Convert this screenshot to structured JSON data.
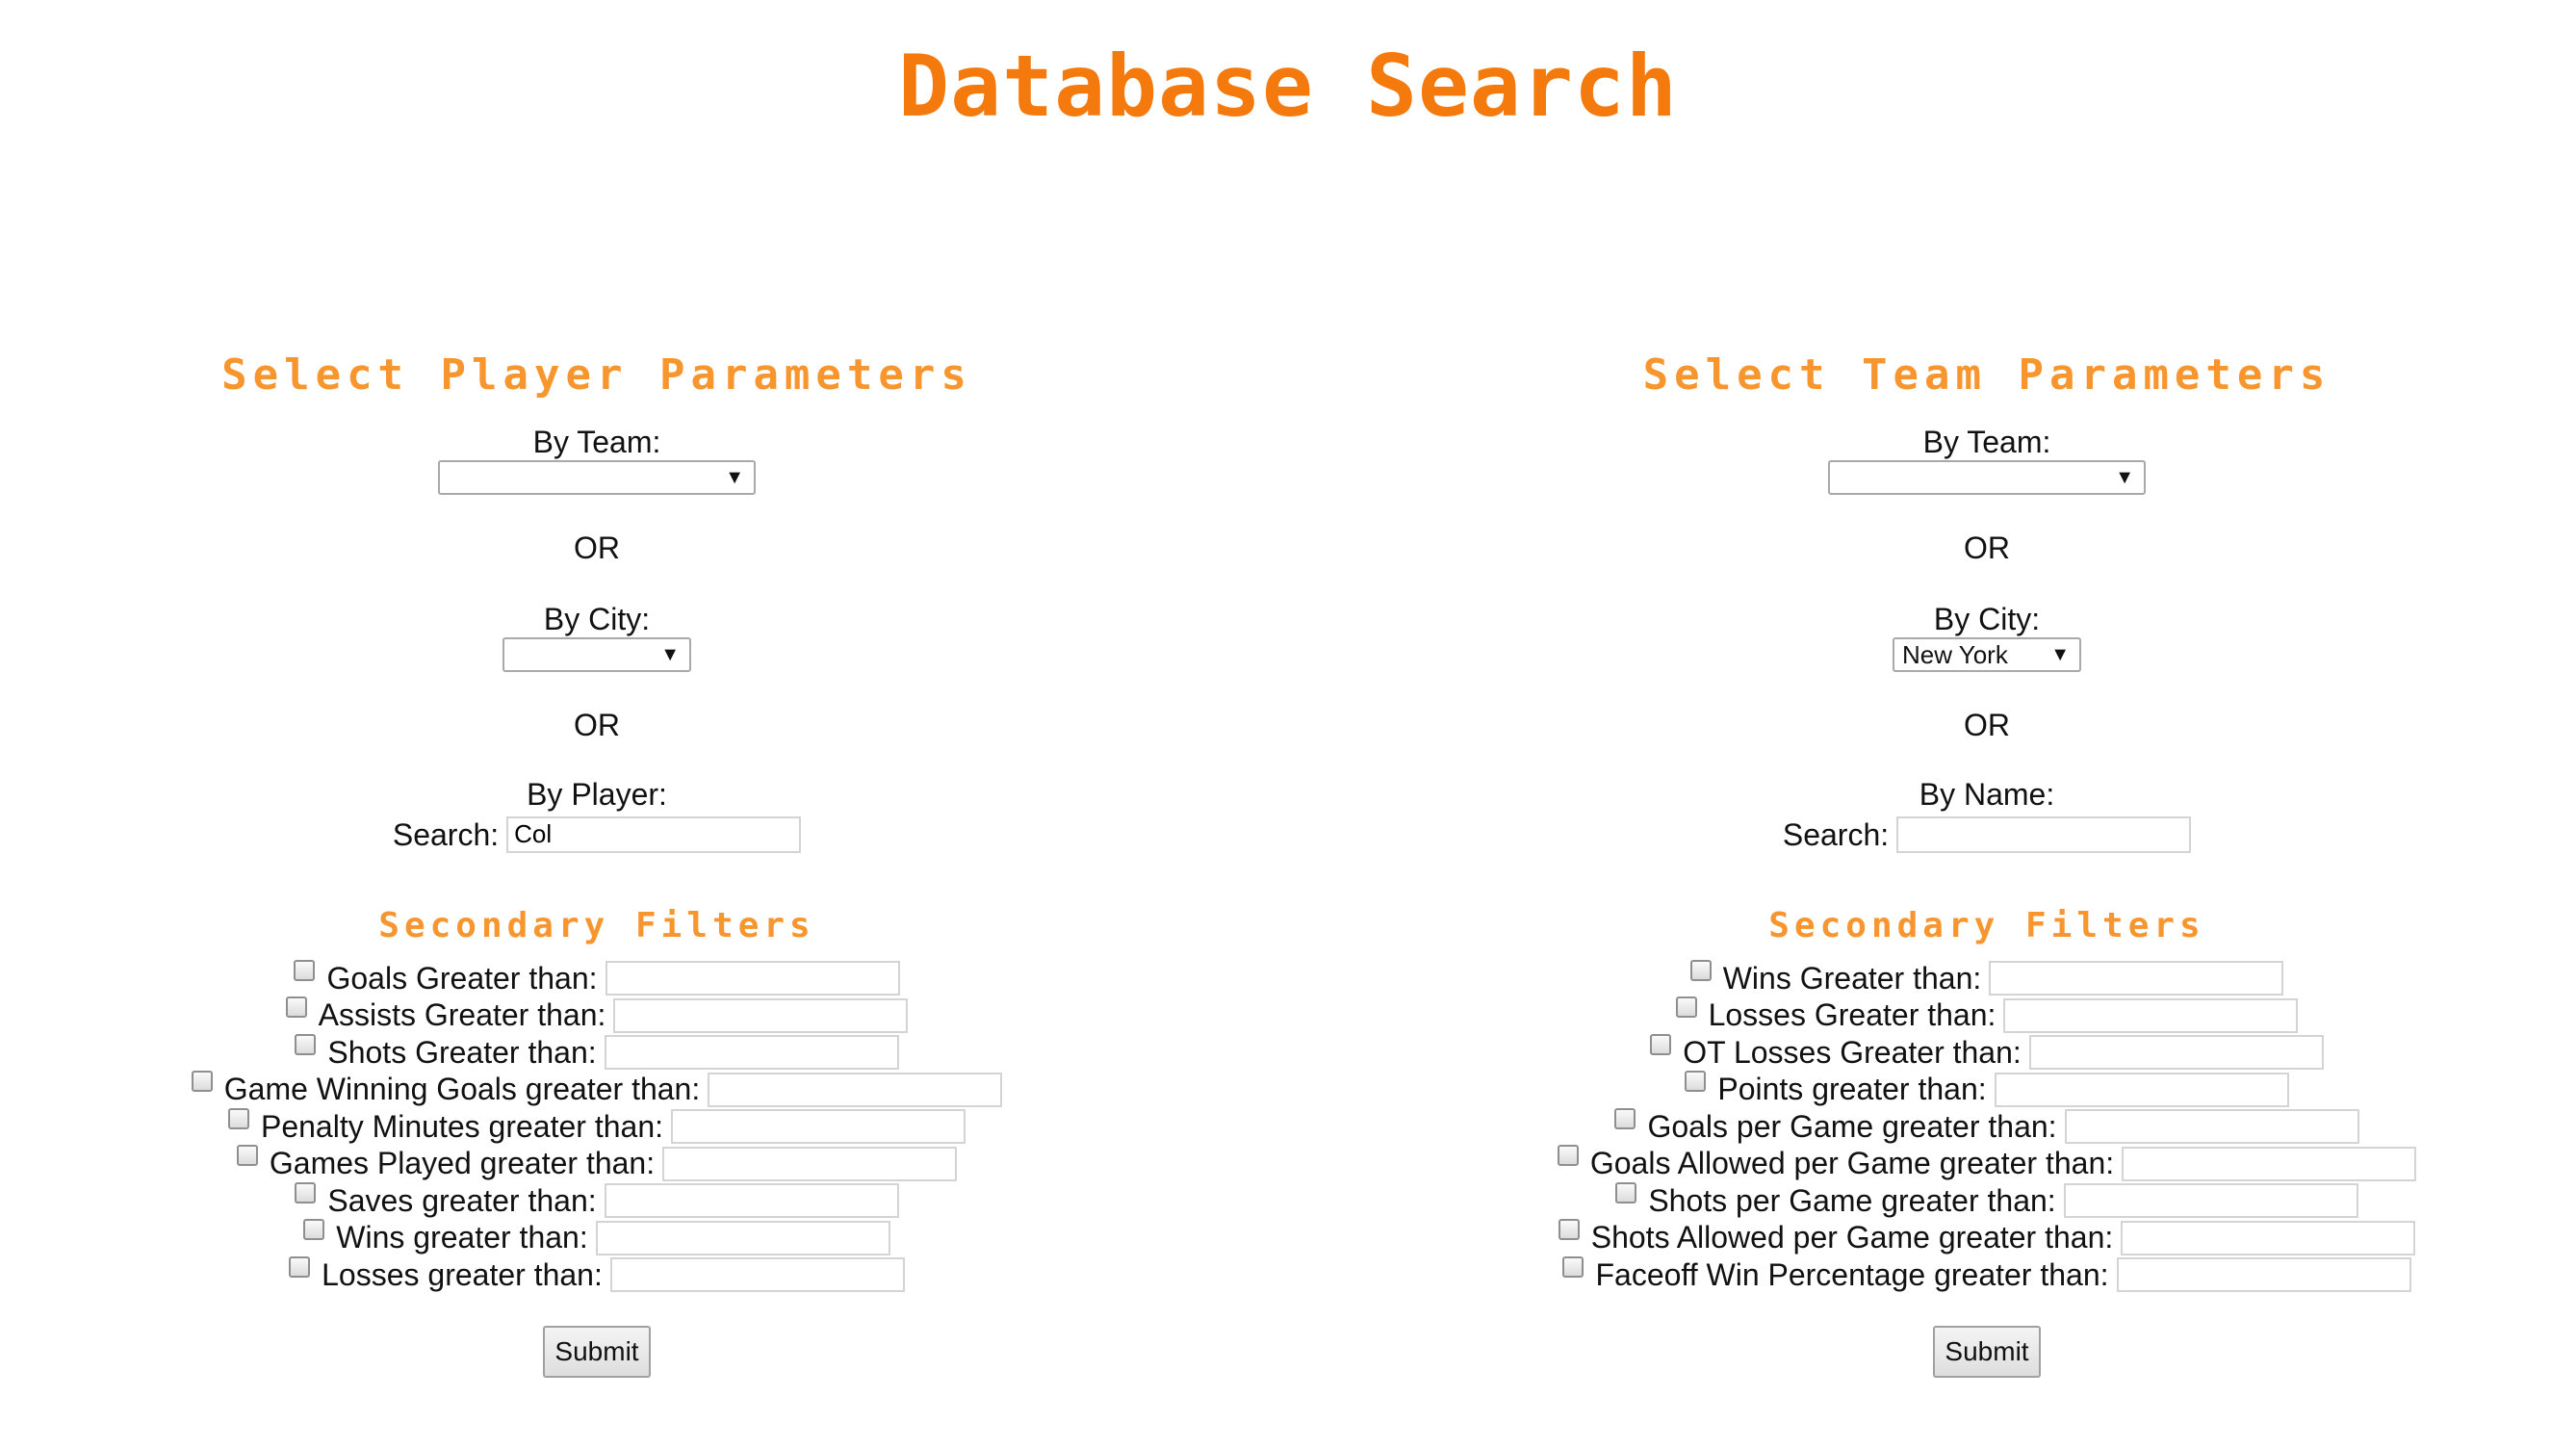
{
  "page": {
    "title": "Database Search"
  },
  "player": {
    "heading": "Select Player Parameters",
    "by_team_label": "By Team:",
    "team_value": "",
    "or_1": "OR",
    "by_city_label": "By City:",
    "city_value": "",
    "or_2": "OR",
    "by_player_label": "By Player:",
    "search_label": "Search:",
    "search_value": "Col",
    "secondary_heading": "Secondary Filters",
    "filters": [
      "Goals Greater than:",
      "Assists Greater than:",
      "Shots Greater than:",
      "Game Winning Goals greater than:",
      "Penalty Minutes greater than:",
      "Games Played greater than:",
      "Saves greater than:",
      "Wins greater than:",
      "Losses greater than:"
    ],
    "submit_label": "Submit"
  },
  "team": {
    "heading": "Select Team Parameters",
    "by_team_label": "By Team:",
    "team_value": "",
    "or_1": "OR",
    "by_city_label": "By City:",
    "city_value": "New York",
    "or_2": "OR",
    "by_name_label": "By Name:",
    "search_label": "Search:",
    "search_value": "",
    "secondary_heading": "Secondary Filters",
    "filters": [
      "Wins Greater than:",
      "Losses Greater than:",
      "OT Losses Greater than:",
      "Points greater than:",
      "Goals per Game greater than:",
      "Goals Allowed per Game greater than:",
      "Shots per Game greater than:",
      "Shots Allowed per Game greater than:",
      "Faceoff Win Percentage greater than:"
    ],
    "submit_label": "Submit"
  },
  "colors": {
    "title": "#f47a0e",
    "heading": "#f7962e"
  },
  "icons": {
    "dropdown": "chevron-down-icon"
  }
}
